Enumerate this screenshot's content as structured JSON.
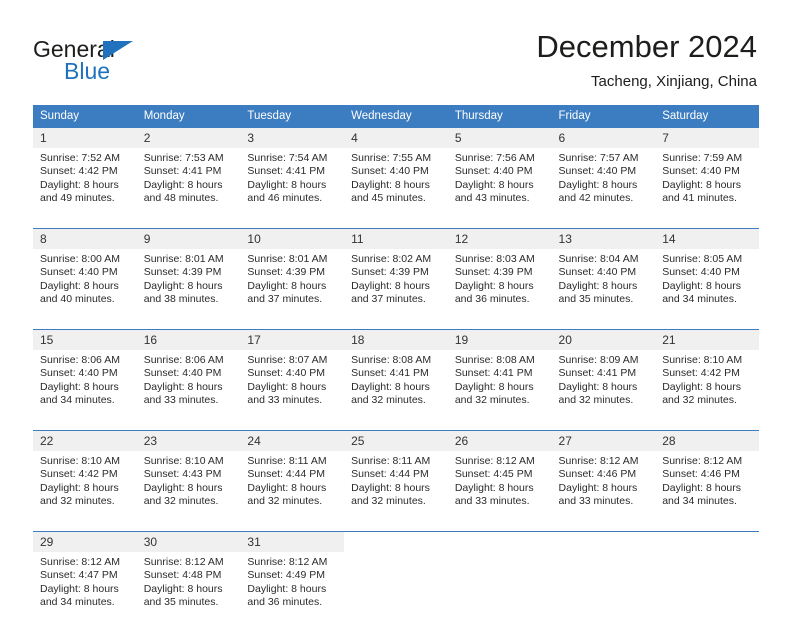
{
  "brand": {
    "name_top": "General",
    "name_bottom": "Blue",
    "triangle_color": "#1f72bb"
  },
  "header": {
    "title": "December 2024",
    "subtitle": "Tacheng, Xinjiang, China"
  },
  "theme": {
    "header_blue": "#3c7cc0",
    "daynum_gray": "#f0f0f0",
    "text_dark": "#1d1d1b"
  },
  "weekdays": [
    "Sunday",
    "Monday",
    "Tuesday",
    "Wednesday",
    "Thursday",
    "Friday",
    "Saturday"
  ],
  "weeks": [
    [
      {
        "day": "1",
        "sunrise": "Sunrise: 7:52 AM",
        "sunset": "Sunset: 4:42 PM",
        "daylight1": "Daylight: 8 hours",
        "daylight2": "and 49 minutes."
      },
      {
        "day": "2",
        "sunrise": "Sunrise: 7:53 AM",
        "sunset": "Sunset: 4:41 PM",
        "daylight1": "Daylight: 8 hours",
        "daylight2": "and 48 minutes."
      },
      {
        "day": "3",
        "sunrise": "Sunrise: 7:54 AM",
        "sunset": "Sunset: 4:41 PM",
        "daylight1": "Daylight: 8 hours",
        "daylight2": "and 46 minutes."
      },
      {
        "day": "4",
        "sunrise": "Sunrise: 7:55 AM",
        "sunset": "Sunset: 4:40 PM",
        "daylight1": "Daylight: 8 hours",
        "daylight2": "and 45 minutes."
      },
      {
        "day": "5",
        "sunrise": "Sunrise: 7:56 AM",
        "sunset": "Sunset: 4:40 PM",
        "daylight1": "Daylight: 8 hours",
        "daylight2": "and 43 minutes."
      },
      {
        "day": "6",
        "sunrise": "Sunrise: 7:57 AM",
        "sunset": "Sunset: 4:40 PM",
        "daylight1": "Daylight: 8 hours",
        "daylight2": "and 42 minutes."
      },
      {
        "day": "7",
        "sunrise": "Sunrise: 7:59 AM",
        "sunset": "Sunset: 4:40 PM",
        "daylight1": "Daylight: 8 hours",
        "daylight2": "and 41 minutes."
      }
    ],
    [
      {
        "day": "8",
        "sunrise": "Sunrise: 8:00 AM",
        "sunset": "Sunset: 4:40 PM",
        "daylight1": "Daylight: 8 hours",
        "daylight2": "and 40 minutes."
      },
      {
        "day": "9",
        "sunrise": "Sunrise: 8:01 AM",
        "sunset": "Sunset: 4:39 PM",
        "daylight1": "Daylight: 8 hours",
        "daylight2": "and 38 minutes."
      },
      {
        "day": "10",
        "sunrise": "Sunrise: 8:01 AM",
        "sunset": "Sunset: 4:39 PM",
        "daylight1": "Daylight: 8 hours",
        "daylight2": "and 37 minutes."
      },
      {
        "day": "11",
        "sunrise": "Sunrise: 8:02 AM",
        "sunset": "Sunset: 4:39 PM",
        "daylight1": "Daylight: 8 hours",
        "daylight2": "and 37 minutes."
      },
      {
        "day": "12",
        "sunrise": "Sunrise: 8:03 AM",
        "sunset": "Sunset: 4:39 PM",
        "daylight1": "Daylight: 8 hours",
        "daylight2": "and 36 minutes."
      },
      {
        "day": "13",
        "sunrise": "Sunrise: 8:04 AM",
        "sunset": "Sunset: 4:40 PM",
        "daylight1": "Daylight: 8 hours",
        "daylight2": "and 35 minutes."
      },
      {
        "day": "14",
        "sunrise": "Sunrise: 8:05 AM",
        "sunset": "Sunset: 4:40 PM",
        "daylight1": "Daylight: 8 hours",
        "daylight2": "and 34 minutes."
      }
    ],
    [
      {
        "day": "15",
        "sunrise": "Sunrise: 8:06 AM",
        "sunset": "Sunset: 4:40 PM",
        "daylight1": "Daylight: 8 hours",
        "daylight2": "and 34 minutes."
      },
      {
        "day": "16",
        "sunrise": "Sunrise: 8:06 AM",
        "sunset": "Sunset: 4:40 PM",
        "daylight1": "Daylight: 8 hours",
        "daylight2": "and 33 minutes."
      },
      {
        "day": "17",
        "sunrise": "Sunrise: 8:07 AM",
        "sunset": "Sunset: 4:40 PM",
        "daylight1": "Daylight: 8 hours",
        "daylight2": "and 33 minutes."
      },
      {
        "day": "18",
        "sunrise": "Sunrise: 8:08 AM",
        "sunset": "Sunset: 4:41 PM",
        "daylight1": "Daylight: 8 hours",
        "daylight2": "and 32 minutes."
      },
      {
        "day": "19",
        "sunrise": "Sunrise: 8:08 AM",
        "sunset": "Sunset: 4:41 PM",
        "daylight1": "Daylight: 8 hours",
        "daylight2": "and 32 minutes."
      },
      {
        "day": "20",
        "sunrise": "Sunrise: 8:09 AM",
        "sunset": "Sunset: 4:41 PM",
        "daylight1": "Daylight: 8 hours",
        "daylight2": "and 32 minutes."
      },
      {
        "day": "21",
        "sunrise": "Sunrise: 8:10 AM",
        "sunset": "Sunset: 4:42 PM",
        "daylight1": "Daylight: 8 hours",
        "daylight2": "and 32 minutes."
      }
    ],
    [
      {
        "day": "22",
        "sunrise": "Sunrise: 8:10 AM",
        "sunset": "Sunset: 4:42 PM",
        "daylight1": "Daylight: 8 hours",
        "daylight2": "and 32 minutes."
      },
      {
        "day": "23",
        "sunrise": "Sunrise: 8:10 AM",
        "sunset": "Sunset: 4:43 PM",
        "daylight1": "Daylight: 8 hours",
        "daylight2": "and 32 minutes."
      },
      {
        "day": "24",
        "sunrise": "Sunrise: 8:11 AM",
        "sunset": "Sunset: 4:44 PM",
        "daylight1": "Daylight: 8 hours",
        "daylight2": "and 32 minutes."
      },
      {
        "day": "25",
        "sunrise": "Sunrise: 8:11 AM",
        "sunset": "Sunset: 4:44 PM",
        "daylight1": "Daylight: 8 hours",
        "daylight2": "and 32 minutes."
      },
      {
        "day": "26",
        "sunrise": "Sunrise: 8:12 AM",
        "sunset": "Sunset: 4:45 PM",
        "daylight1": "Daylight: 8 hours",
        "daylight2": "and 33 minutes."
      },
      {
        "day": "27",
        "sunrise": "Sunrise: 8:12 AM",
        "sunset": "Sunset: 4:46 PM",
        "daylight1": "Daylight: 8 hours",
        "daylight2": "and 33 minutes."
      },
      {
        "day": "28",
        "sunrise": "Sunrise: 8:12 AM",
        "sunset": "Sunset: 4:46 PM",
        "daylight1": "Daylight: 8 hours",
        "daylight2": "and 34 minutes."
      }
    ],
    [
      {
        "day": "29",
        "sunrise": "Sunrise: 8:12 AM",
        "sunset": "Sunset: 4:47 PM",
        "daylight1": "Daylight: 8 hours",
        "daylight2": "and 34 minutes."
      },
      {
        "day": "30",
        "sunrise": "Sunrise: 8:12 AM",
        "sunset": "Sunset: 4:48 PM",
        "daylight1": "Daylight: 8 hours",
        "daylight2": "and 35 minutes."
      },
      {
        "day": "31",
        "sunrise": "Sunrise: 8:12 AM",
        "sunset": "Sunset: 4:49 PM",
        "daylight1": "Daylight: 8 hours",
        "daylight2": "and 36 minutes."
      },
      {
        "day": "",
        "sunrise": "",
        "sunset": "",
        "daylight1": "",
        "daylight2": ""
      },
      {
        "day": "",
        "sunrise": "",
        "sunset": "",
        "daylight1": "",
        "daylight2": ""
      },
      {
        "day": "",
        "sunrise": "",
        "sunset": "",
        "daylight1": "",
        "daylight2": ""
      },
      {
        "day": "",
        "sunrise": "",
        "sunset": "",
        "daylight1": "",
        "daylight2": ""
      }
    ]
  ]
}
